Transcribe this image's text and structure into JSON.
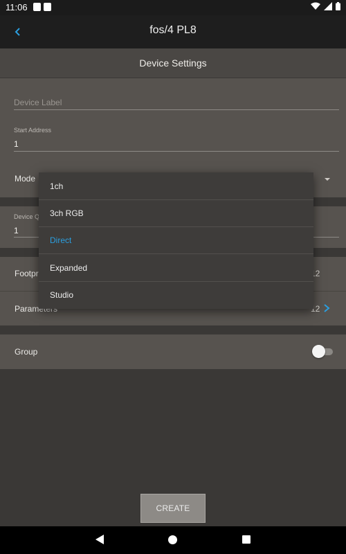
{
  "status_bar": {
    "time": "11:06"
  },
  "app_bar": {
    "title": "fos/4 PL8"
  },
  "section": {
    "title": "Device Settings"
  },
  "form": {
    "device_label_placeholder": "Device Label",
    "start_address_label": "Start Address",
    "start_address_value": "1",
    "mode_label": "Mode",
    "device_quantity_label": "Device Q",
    "device_quantity_value": "1",
    "footprint_label": "Footpri",
    "footprint_value": "12",
    "parameters_label": "Parameters",
    "parameters_value": "12",
    "group_label": "Group",
    "group_enabled": false
  },
  "mode_menu": {
    "options": [
      {
        "label": "1ch"
      },
      {
        "label": "3ch RGB"
      },
      {
        "label": "Direct"
      },
      {
        "label": "Expanded"
      },
      {
        "label": "Studio"
      }
    ],
    "selected": "Direct"
  },
  "actions": {
    "create_label": "CREATE"
  },
  "colors": {
    "accent": "#2b9fe0",
    "app_bar": "#1e1e1e",
    "background": "#3a3836",
    "panel": "#57534f"
  },
  "icons": {
    "back": "chevron-left-icon",
    "dropdown": "caret-down-icon",
    "parameters": "chevron-right-icon",
    "nav_back": "triangle-back-icon",
    "nav_home": "circle-home-icon",
    "nav_recent": "square-recents-icon"
  }
}
